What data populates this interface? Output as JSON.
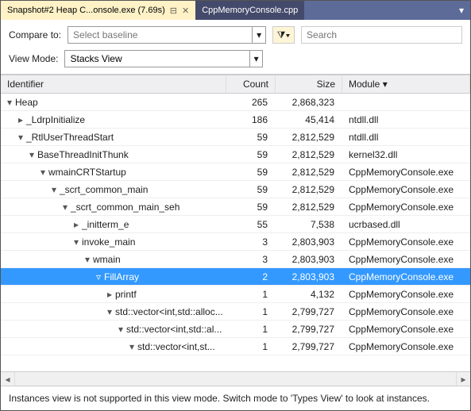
{
  "tabs": {
    "active": "Snapshot#2 Heap C...onsole.exe (7.69s)",
    "inactive": "CppMemoryConsole.cpp"
  },
  "toolbar": {
    "compare_label": "Compare to:",
    "baseline_placeholder": "Select baseline",
    "search_placeholder": "Search",
    "viewmode_label": "View Mode:",
    "viewmode_value": "Stacks View"
  },
  "columns": {
    "identifier": "Identifier",
    "count": "Count",
    "size": "Size",
    "module": "Module"
  },
  "rows": [
    {
      "depth": 0,
      "toggle": "▾",
      "label": "Heap",
      "count": "265",
      "size": "2,868,323",
      "module": "",
      "sel": false
    },
    {
      "depth": 1,
      "toggle": "▸",
      "label": "_LdrpInitialize",
      "count": "186",
      "size": "45,414",
      "module": "ntdll.dll",
      "sel": false
    },
    {
      "depth": 1,
      "toggle": "▾",
      "label": "_RtlUserThreadStart",
      "count": "59",
      "size": "2,812,529",
      "module": "ntdll.dll",
      "sel": false
    },
    {
      "depth": 2,
      "toggle": "▾",
      "label": "BaseThreadInitThunk",
      "count": "59",
      "size": "2,812,529",
      "module": "kernel32.dll",
      "sel": false
    },
    {
      "depth": 3,
      "toggle": "▾",
      "label": "wmainCRTStartup",
      "count": "59",
      "size": "2,812,529",
      "module": "CppMemoryConsole.exe",
      "sel": false
    },
    {
      "depth": 4,
      "toggle": "▾",
      "label": "_scrt_common_main",
      "count": "59",
      "size": "2,812,529",
      "module": "CppMemoryConsole.exe",
      "sel": false
    },
    {
      "depth": 5,
      "toggle": "▾",
      "label": "_scrt_common_main_seh",
      "count": "59",
      "size": "2,812,529",
      "module": "CppMemoryConsole.exe",
      "sel": false
    },
    {
      "depth": 6,
      "toggle": "▸",
      "label": "_initterm_e",
      "count": "55",
      "size": "7,538",
      "module": "ucrbased.dll",
      "sel": false
    },
    {
      "depth": 6,
      "toggle": "▾",
      "label": "invoke_main",
      "count": "3",
      "size": "2,803,903",
      "module": "CppMemoryConsole.exe",
      "sel": false
    },
    {
      "depth": 7,
      "toggle": "▾",
      "label": "wmain",
      "count": "3",
      "size": "2,803,903",
      "module": "CppMemoryConsole.exe",
      "sel": false
    },
    {
      "depth": 8,
      "toggle": "▿",
      "label": "FillArray",
      "count": "2",
      "size": "2,803,903",
      "module": "CppMemoryConsole.exe",
      "sel": true
    },
    {
      "depth": 9,
      "toggle": "▸",
      "label": "printf",
      "count": "1",
      "size": "4,132",
      "module": "CppMemoryConsole.exe",
      "sel": false
    },
    {
      "depth": 9,
      "toggle": "▾",
      "label": "std::vector<int,std::alloc...",
      "count": "1",
      "size": "2,799,727",
      "module": "CppMemoryConsole.exe",
      "sel": false
    },
    {
      "depth": 10,
      "toggle": "▾",
      "label": "std::vector<int,std::al...",
      "count": "1",
      "size": "2,799,727",
      "module": "CppMemoryConsole.exe",
      "sel": false
    },
    {
      "depth": 11,
      "toggle": "▾",
      "label": "std::vector<int,st...",
      "count": "1",
      "size": "2,799,727",
      "module": "CppMemoryConsole.exe",
      "sel": false
    }
  ],
  "status": "Instances view is not supported in this view mode. Switch mode to 'Types View' to look at instances."
}
